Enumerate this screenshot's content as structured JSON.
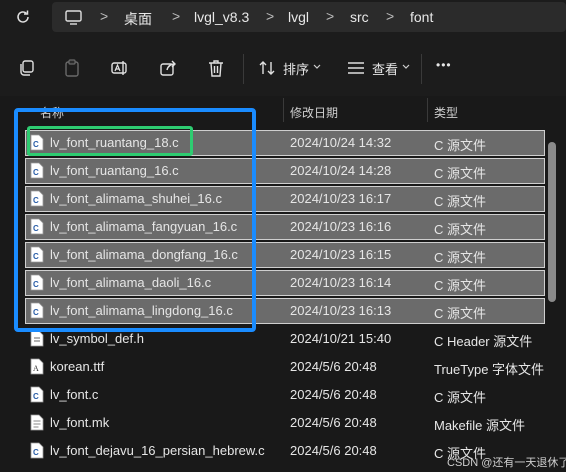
{
  "address": {
    "crumbs": [
      "桌面",
      "lvgl_v8.3",
      "lvgl",
      "src",
      "font"
    ],
    "separator": ">"
  },
  "toolbar": {
    "sort_label": "排序",
    "view_label": "查看",
    "more_label": "•••"
  },
  "columns": {
    "name": "名称",
    "date": "修改日期",
    "type": "类型"
  },
  "files": [
    {
      "name": "lv_font_ruantang_18.c",
      "date": "2024/10/24 14:32",
      "type": "C 源文件",
      "selected": true,
      "icon": "c-file-icon"
    },
    {
      "name": "lv_font_ruantang_16.c",
      "date": "2024/10/24 14:28",
      "type": "C 源文件",
      "selected": true,
      "icon": "c-file-icon"
    },
    {
      "name": "lv_font_alimama_shuhei_16.c",
      "date": "2024/10/23 16:17",
      "type": "C 源文件",
      "selected": true,
      "icon": "c-file-icon"
    },
    {
      "name": "lv_font_alimama_fangyuan_16.c",
      "date": "2024/10/23 16:16",
      "type": "C 源文件",
      "selected": true,
      "icon": "c-file-icon"
    },
    {
      "name": "lv_font_alimama_dongfang_16.c",
      "date": "2024/10/23 16:15",
      "type": "C 源文件",
      "selected": true,
      "icon": "c-file-icon"
    },
    {
      "name": "lv_font_alimama_daoli_16.c",
      "date": "2024/10/23 16:14",
      "type": "C 源文件",
      "selected": true,
      "icon": "c-file-icon"
    },
    {
      "name": "lv_font_alimama_lingdong_16.c",
      "date": "2024/10/23 16:13",
      "type": "C 源文件",
      "selected": true,
      "icon": "c-file-icon"
    },
    {
      "name": "lv_symbol_def.h",
      "date": "2024/10/21 15:40",
      "type": "C Header 源文件",
      "selected": false,
      "icon": "h-file-icon"
    },
    {
      "name": "korean.ttf",
      "date": "2024/5/6 20:48",
      "type": "TrueType 字体文件",
      "selected": false,
      "icon": "font-file-icon"
    },
    {
      "name": "lv_font.c",
      "date": "2024/5/6 20:48",
      "type": "C 源文件",
      "selected": false,
      "icon": "c-file-icon"
    },
    {
      "name": "lv_font.mk",
      "date": "2024/5/6 20:48",
      "type": "Makefile 源文件",
      "selected": false,
      "icon": "doc-file-icon"
    },
    {
      "name": "lv_font_dejavu_16_persian_hebrew.c",
      "date": "2024/5/6 20:48",
      "type": "C 源文件",
      "selected": false,
      "icon": "c-file-icon"
    }
  ],
  "watermark": "CSDN @还有一天退休了",
  "colors": {
    "selection": "#6b6b6b",
    "highlight_blue": "#1a8cff",
    "highlight_green": "#2ecc71",
    "background": "#191919"
  }
}
